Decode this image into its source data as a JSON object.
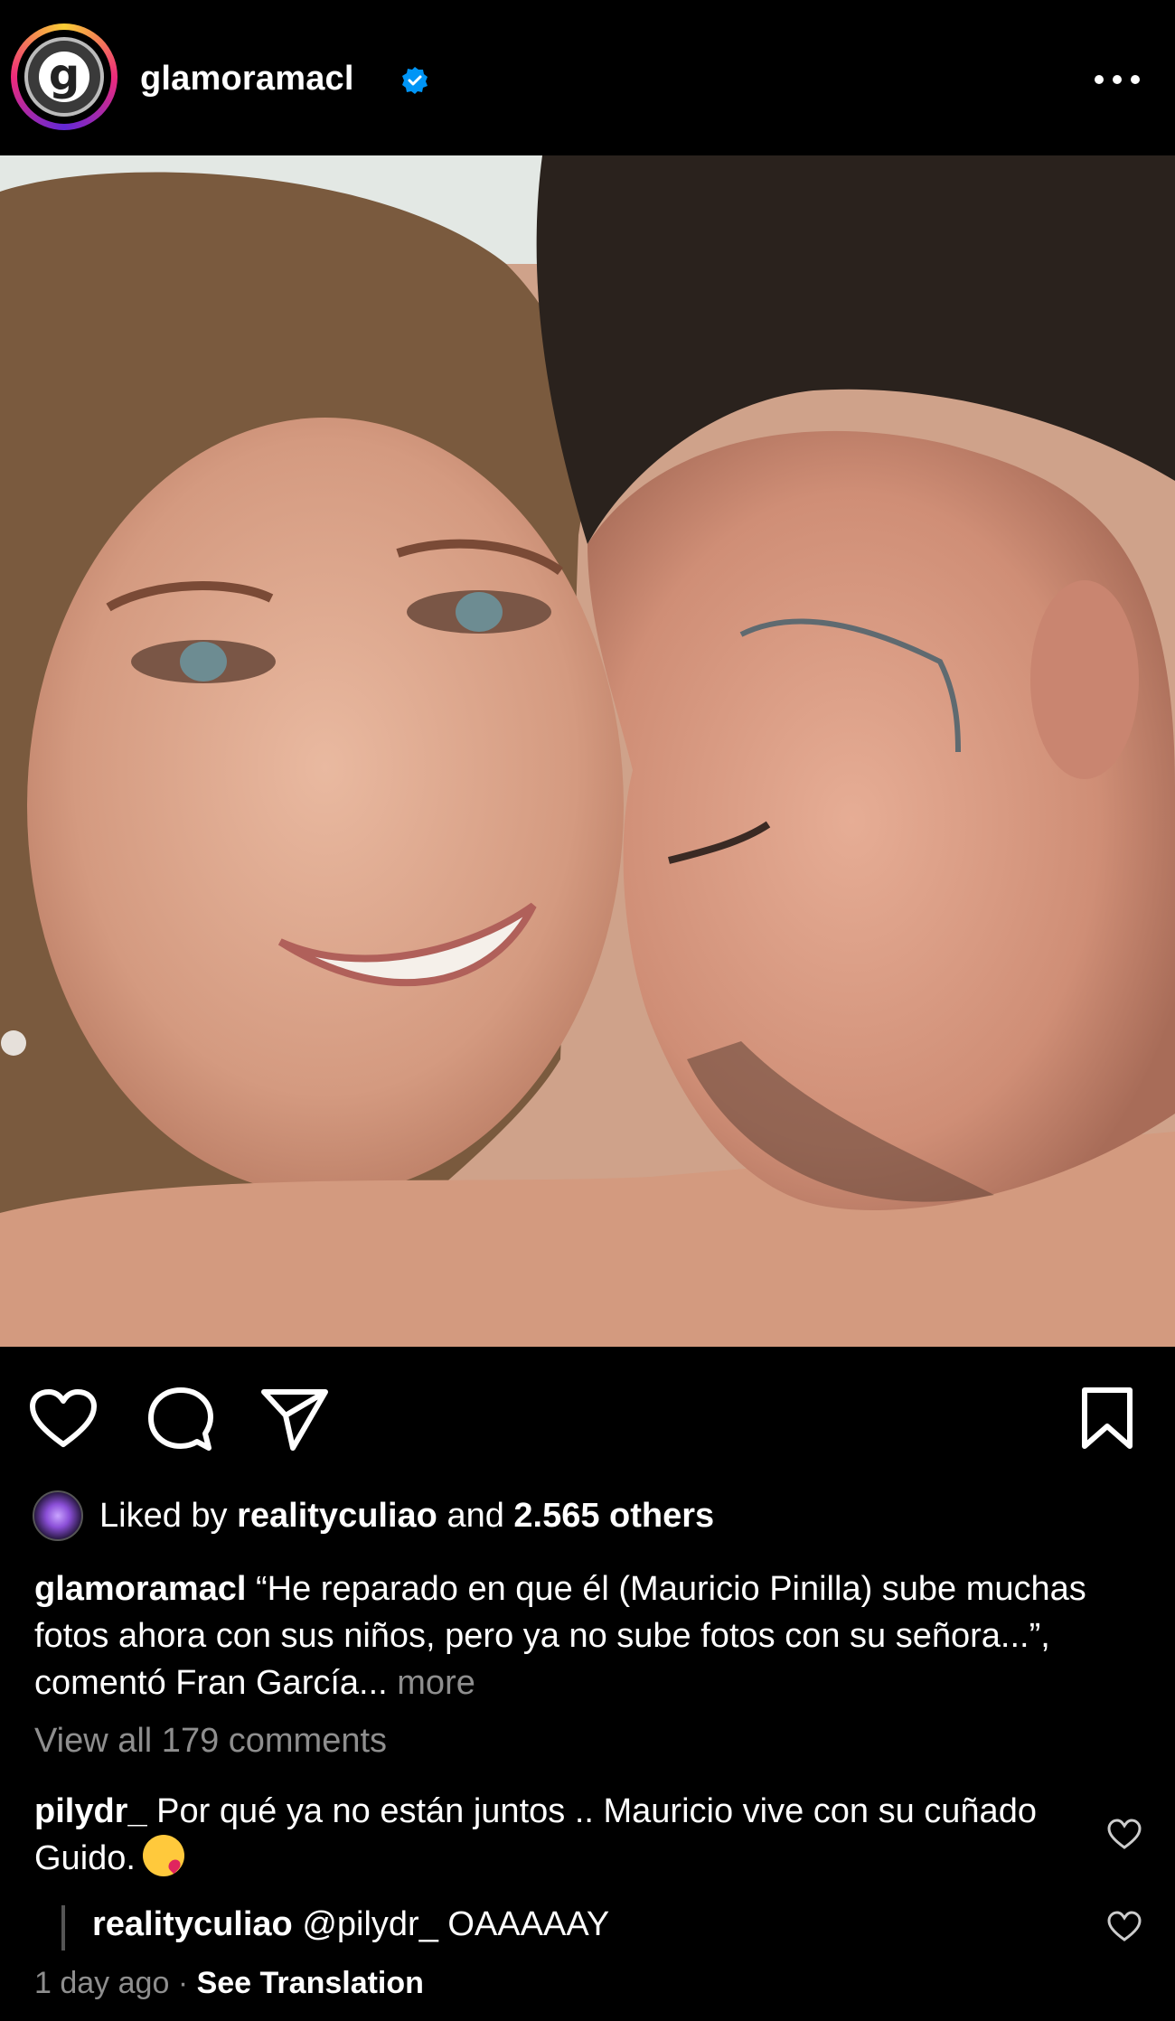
{
  "header": {
    "avatar_letter": "g",
    "username": "glamoramacl",
    "verified": true,
    "more_icon": "more-horizontal-icon"
  },
  "post": {
    "image_alt": "photo-of-couple"
  },
  "actions": {
    "like_icon": "heart-icon",
    "comment_icon": "comment-icon",
    "share_icon": "send-icon",
    "save_icon": "bookmark-icon"
  },
  "likes": {
    "prefix": "Liked by",
    "user": "realityculiao",
    "middle": "and",
    "count": "2.565 others"
  },
  "caption": {
    "username": "glamoramacl",
    "text": "“He reparado en que él (Mauricio Pinilla) sube muchas fotos ahora con sus niños, pero ya no sube fotos con su señora...”, comentó Fran García...",
    "more": "more"
  },
  "view_all_comments": "View all 179 comments",
  "comments": [
    {
      "username": "pilydr_",
      "text": "Por qué ya no están juntos .. Mauricio vive con su cuñado Guido.",
      "emoji": "kissing-face-emoji"
    }
  ],
  "reply": {
    "username": "realityculiao",
    "text": "@pilydr_ OAAAAAY"
  },
  "footer": {
    "time": "1 day ago",
    "separator": "·",
    "translate": "See Translation"
  },
  "colors": {
    "background": "#000000",
    "text": "#ffffff",
    "secondary": "#8e8e8e",
    "verified": "#0095f6"
  }
}
